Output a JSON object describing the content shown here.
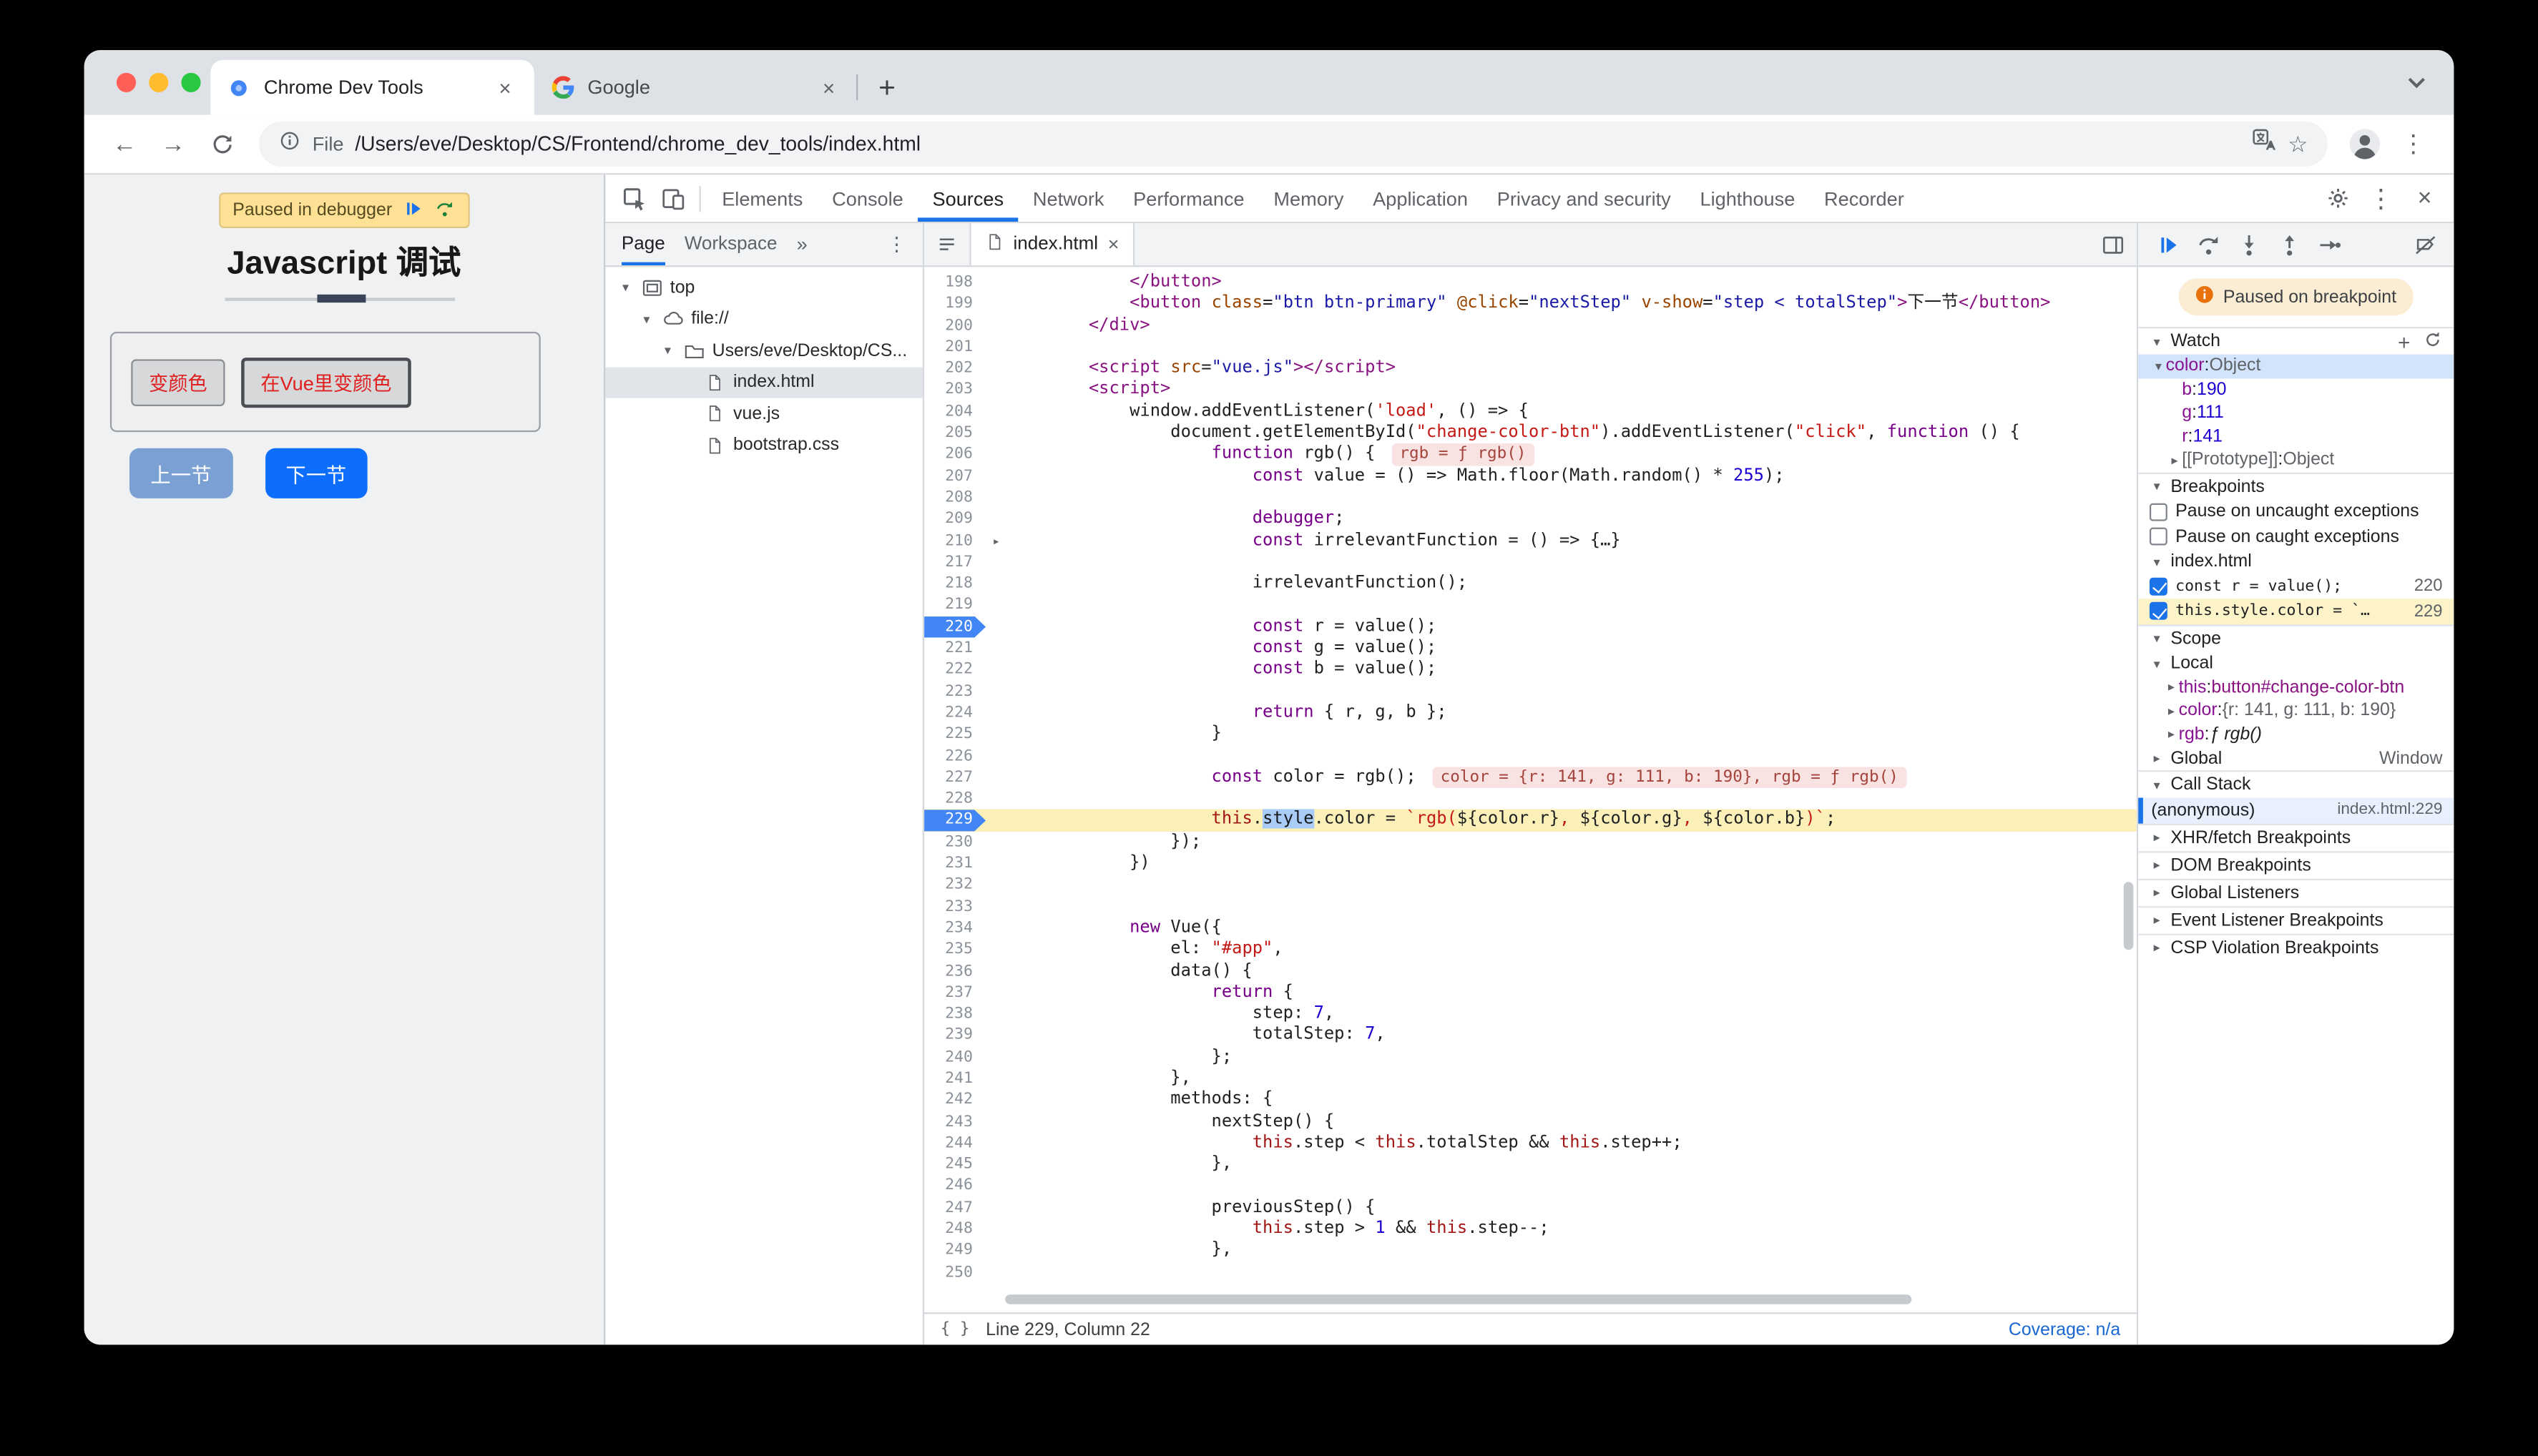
{
  "browser": {
    "tabs": [
      {
        "title": "Chrome Dev Tools",
        "active": true
      },
      {
        "title": "Google",
        "active": false
      }
    ],
    "url": {
      "chip": "File",
      "path": "/Users/eve/Desktop/CS/Frontend/chrome_dev_tools/index.html"
    }
  },
  "page": {
    "paused_banner": "Paused in debugger",
    "title": "Javascript 调试",
    "color_buttons": [
      "变颜色",
      "在Vue里变颜色"
    ],
    "nav_buttons": {
      "prev": "上一节",
      "next": "下一节"
    }
  },
  "devtools": {
    "tabbar": {
      "tabs": [
        "Elements",
        "Console",
        "Sources",
        "Network",
        "Performance",
        "Memory",
        "Application",
        "Privacy and security",
        "Lighthouse",
        "Recorder"
      ],
      "active": "Sources"
    },
    "navigator": {
      "page_tab": "Page",
      "workspace_tab": "Workspace",
      "tree": [
        {
          "label": "top",
          "icon": "frame",
          "depth": 0,
          "chevron": true
        },
        {
          "label": "file://",
          "icon": "cloud",
          "depth": 1,
          "chevron": true
        },
        {
          "label": "Users/eve/Desktop/CS...",
          "icon": "folder",
          "depth": 2,
          "chevron": true
        },
        {
          "label": "index.html",
          "icon": "file",
          "depth": 3,
          "selected": true
        },
        {
          "label": "vue.js",
          "icon": "file",
          "depth": 3
        },
        {
          "label": "bootstrap.css",
          "icon": "file",
          "depth": 3
        }
      ]
    },
    "editor": {
      "file_tab": "index.html",
      "status_left": "Line 229, Column 22",
      "status_right": "Coverage: n/a",
      "lines": [
        {
          "n": 198,
          "t": [
            [
              "pl",
              "            "
            ],
            [
              "tg",
              "</button>"
            ]
          ]
        },
        {
          "n": 199,
          "t": [
            [
              "pl",
              "            "
            ],
            [
              "tg",
              "<button"
            ],
            [
              "pl",
              " "
            ],
            [
              "at",
              "class"
            ],
            [
              "pl",
              "="
            ],
            [
              "av",
              "\"btn btn-primary\""
            ],
            [
              "pl",
              " "
            ],
            [
              "at",
              "@click"
            ],
            [
              "pl",
              "="
            ],
            [
              "av",
              "\"nextStep\""
            ],
            [
              "pl",
              " "
            ],
            [
              "at",
              "v-show"
            ],
            [
              "pl",
              "="
            ],
            [
              "av",
              "\"step < totalStep\""
            ],
            [
              "tg",
              ">"
            ],
            [
              "pl",
              "下一节"
            ],
            [
              "tg",
              "</button>"
            ]
          ]
        },
        {
          "n": 200,
          "t": [
            [
              "pl",
              "        "
            ],
            [
              "tg",
              "</div>"
            ]
          ]
        },
        {
          "n": 201,
          "t": []
        },
        {
          "n": 202,
          "t": [
            [
              "pl",
              "        "
            ],
            [
              "tg",
              "<script"
            ],
            [
              "pl",
              " "
            ],
            [
              "at",
              "src"
            ],
            [
              "pl",
              "="
            ],
            [
              "av",
              "\"vue.js\""
            ],
            [
              "tg",
              "></script>"
            ]
          ]
        },
        {
          "n": 203,
          "t": [
            [
              "pl",
              "        "
            ],
            [
              "tg",
              "<script>"
            ]
          ]
        },
        {
          "n": 204,
          "t": [
            [
              "pl",
              "            window.addEventListener("
            ],
            [
              "st",
              "'load'"
            ],
            [
              "pl",
              ", () => {"
            ]
          ]
        },
        {
          "n": 205,
          "t": [
            [
              "pl",
              "                document.getElementById("
            ],
            [
              "st",
              "\"change-color-btn\""
            ],
            [
              "pl",
              ").addEventListener("
            ],
            [
              "st",
              "\"click\""
            ],
            [
              "pl",
              ", "
            ],
            [
              "kw",
              "function"
            ],
            [
              "pl",
              " () {"
            ]
          ]
        },
        {
          "n": 206,
          "t": [
            [
              "pl",
              "                    "
            ],
            [
              "kw",
              "function"
            ],
            [
              "pl",
              " rgb() {"
            ]
          ],
          "ev": "rgb = ƒ rgb()"
        },
        {
          "n": 207,
          "t": [
            [
              "pl",
              "                        "
            ],
            [
              "kw",
              "const"
            ],
            [
              "pl",
              " value = () => Math.floor(Math.random() * "
            ],
            [
              "nm",
              "255"
            ],
            [
              "pl",
              ");"
            ]
          ]
        },
        {
          "n": 208,
          "t": []
        },
        {
          "n": 209,
          "t": [
            [
              "pl",
              "                        "
            ],
            [
              "kw",
              "debugger"
            ],
            [
              "pl",
              ";"
            ]
          ]
        },
        {
          "n": 210,
          "t": [
            [
              "pl",
              "                        "
            ],
            [
              "kw",
              "const"
            ],
            [
              "pl",
              " irrelevantFunction = () => {…}"
            ]
          ],
          "fold": true
        },
        {
          "n": 217,
          "t": []
        },
        {
          "n": 218,
          "t": [
            [
              "pl",
              "                        irrelevantFunction();"
            ]
          ]
        },
        {
          "n": 219,
          "t": []
        },
        {
          "n": 220,
          "t": [
            [
              "pl",
              "                        "
            ],
            [
              "kw",
              "const"
            ],
            [
              "pl",
              " r = value();"
            ]
          ],
          "bp": true
        },
        {
          "n": 221,
          "t": [
            [
              "pl",
              "                        "
            ],
            [
              "kw",
              "const"
            ],
            [
              "pl",
              " g = value();"
            ]
          ]
        },
        {
          "n": 222,
          "t": [
            [
              "pl",
              "                        "
            ],
            [
              "kw",
              "const"
            ],
            [
              "pl",
              " b = value();"
            ]
          ]
        },
        {
          "n": 223,
          "t": []
        },
        {
          "n": 224,
          "t": [
            [
              "pl",
              "                        "
            ],
            [
              "kw",
              "return"
            ],
            [
              "pl",
              " { r, g, b };"
            ]
          ]
        },
        {
          "n": 225,
          "t": [
            [
              "pl",
              "                    }"
            ]
          ]
        },
        {
          "n": 226,
          "t": []
        },
        {
          "n": 227,
          "t": [
            [
              "pl",
              "                    "
            ],
            [
              "kw",
              "const"
            ],
            [
              "pl",
              " color = rgb();"
            ]
          ],
          "ev": "color = {r: 141, g: 111, b: 190}, rgb = ƒ rgb()"
        },
        {
          "n": 228,
          "t": []
        },
        {
          "n": 229,
          "t": [
            [
              "pl",
              "                    "
            ],
            [
              "th",
              "this"
            ],
            [
              "pl",
              "."
            ],
            [
              "sel",
              "style"
            ],
            [
              "pl",
              ".color = "
            ],
            [
              "st",
              "`rgb("
            ],
            [
              "pl",
              "${color.r}"
            ],
            [
              "st",
              ", "
            ],
            [
              "pl",
              "${color.g}"
            ],
            [
              "st",
              ", "
            ],
            [
              "pl",
              "${color.b}"
            ],
            [
              "st",
              ")`"
            ],
            [
              "pl",
              ";"
            ]
          ],
          "bp": true,
          "cur": true
        },
        {
          "n": 230,
          "t": [
            [
              "pl",
              "                });"
            ]
          ]
        },
        {
          "n": 231,
          "t": [
            [
              "pl",
              "            })"
            ]
          ]
        },
        {
          "n": 232,
          "t": []
        },
        {
          "n": 233,
          "t": []
        },
        {
          "n": 234,
          "t": [
            [
              "pl",
              "            "
            ],
            [
              "kw",
              "new"
            ],
            [
              "pl",
              " Vue({"
            ]
          ]
        },
        {
          "n": 235,
          "t": [
            [
              "pl",
              "                el: "
            ],
            [
              "st",
              "\"#app\""
            ],
            [
              "pl",
              ","
            ]
          ]
        },
        {
          "n": 236,
          "t": [
            [
              "pl",
              "                data() {"
            ]
          ]
        },
        {
          "n": 237,
          "t": [
            [
              "pl",
              "                    "
            ],
            [
              "kw",
              "return"
            ],
            [
              "pl",
              " {"
            ]
          ]
        },
        {
          "n": 238,
          "t": [
            [
              "pl",
              "                        step: "
            ],
            [
              "nm",
              "7"
            ],
            [
              "pl",
              ","
            ]
          ]
        },
        {
          "n": 239,
          "t": [
            [
              "pl",
              "                        totalStep: "
            ],
            [
              "nm",
              "7"
            ],
            [
              "pl",
              ","
            ]
          ]
        },
        {
          "n": 240,
          "t": [
            [
              "pl",
              "                    };"
            ]
          ]
        },
        {
          "n": 241,
          "t": [
            [
              "pl",
              "                },"
            ]
          ]
        },
        {
          "n": 242,
          "t": [
            [
              "pl",
              "                methods: {"
            ]
          ]
        },
        {
          "n": 243,
          "t": [
            [
              "pl",
              "                    nextStep() {"
            ]
          ]
        },
        {
          "n": 244,
          "t": [
            [
              "pl",
              "                        "
            ],
            [
              "th",
              "this"
            ],
            [
              "pl",
              ".step < "
            ],
            [
              "th",
              "this"
            ],
            [
              "pl",
              ".totalStep && "
            ],
            [
              "th",
              "this"
            ],
            [
              "pl",
              ".step++;"
            ]
          ]
        },
        {
          "n": 245,
          "t": [
            [
              "pl",
              "                    },"
            ]
          ]
        },
        {
          "n": 246,
          "t": []
        },
        {
          "n": 247,
          "t": [
            [
              "pl",
              "                    previousStep() {"
            ]
          ]
        },
        {
          "n": 248,
          "t": [
            [
              "pl",
              "                        "
            ],
            [
              "th",
              "this"
            ],
            [
              "pl",
              ".step > "
            ],
            [
              "nm",
              "1"
            ],
            [
              "pl",
              " && "
            ],
            [
              "th",
              "this"
            ],
            [
              "pl",
              ".step--;"
            ]
          ]
        },
        {
          "n": 249,
          "t": [
            [
              "pl",
              "                    },"
            ]
          ]
        },
        {
          "n": 250,
          "t": []
        }
      ]
    },
    "debugger": {
      "paused_pill": "Paused on breakpoint",
      "watch": {
        "title": "Watch",
        "rows": [
          {
            "name": "color",
            "value": "Object",
            "depth": 0,
            "expanded": true,
            "selected": true,
            "vclass": "obj"
          },
          {
            "name": "b",
            "value": "190",
            "depth": 1,
            "vclass": "num"
          },
          {
            "name": "g",
            "value": "111",
            "depth": 1,
            "vclass": "num"
          },
          {
            "name": "r",
            "value": "141",
            "depth": 1,
            "vclass": "num"
          },
          {
            "name": "[[Prototype]]",
            "value": "Object",
            "depth": 1,
            "chevron": true,
            "proto": true,
            "vclass": "obj"
          }
        ]
      },
      "breakpoints": {
        "title": "Breakpoints",
        "toggles": [
          "Pause on uncaught exceptions",
          "Pause on caught exceptions"
        ],
        "group": "index.html",
        "entries": [
          {
            "code": "const r = value();",
            "line": "220",
            "checked": true,
            "active": false
          },
          {
            "code": "this.style.color = `…",
            "line": "229",
            "checked": true,
            "active": true
          }
        ]
      },
      "scope": {
        "title": "Scope",
        "local_label": "Local",
        "local_rows": [
          {
            "name": "this",
            "value": "button#change-color-btn",
            "vclass": "node"
          },
          {
            "name": "color",
            "value": "{r: 141, g: 111, b: 190}",
            "vclass": "obj"
          },
          {
            "name": "rgb",
            "value": "ƒ rgb()",
            "vclass": "fn"
          }
        ],
        "global_label": "Global",
        "global_value": "Window"
      },
      "call_stack": {
        "title": "Call Stack",
        "frames": [
          {
            "fn": "(anonymous)",
            "loc": "index.html:229",
            "active": true
          }
        ]
      },
      "collapsed_sections": [
        "XHR/fetch Breakpoints",
        "DOM Breakpoints",
        "Global Listeners",
        "Event Listener Breakpoints",
        "CSP Violation Breakpoints"
      ]
    }
  }
}
